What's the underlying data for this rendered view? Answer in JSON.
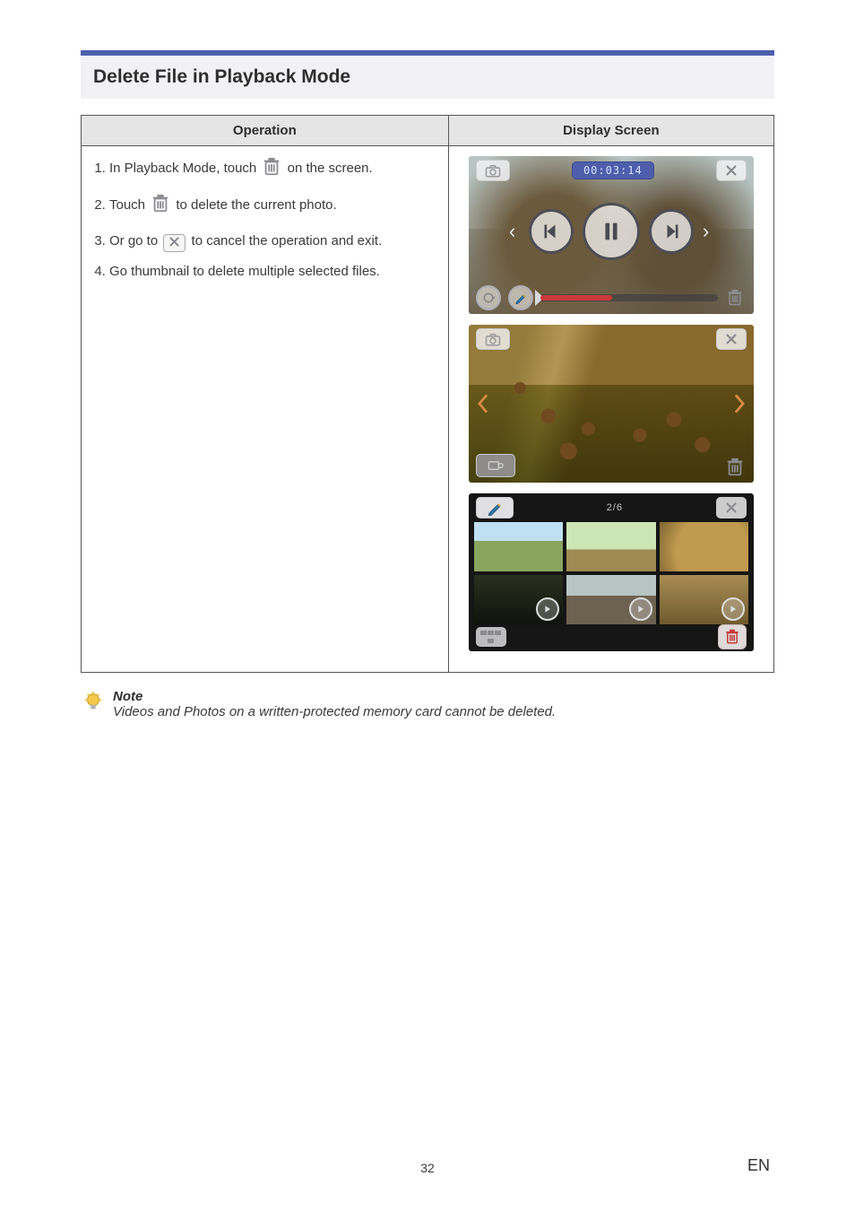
{
  "section": {
    "title": "Delete File in Playback Mode"
  },
  "table": {
    "headers": {
      "operation": "Operation",
      "display": "Display Screen"
    }
  },
  "operations": {
    "step1_a": "In Playback Mode, touch ",
    "step1_b": " on the screen.",
    "step2_a": "Touch ",
    "step2_b": " to delete the current photo.",
    "step3_a": "Or go to ",
    "step3_b": " to cancel the operation and exit.",
    "step4": "Go thumbnail to delete multiple selected files."
  },
  "icons": {
    "trash": "trash-icon",
    "x": "x-icon",
    "camera": "camera-icon",
    "close": "close-icon",
    "prev": "prev-icon",
    "next": "next-icon",
    "pause": "pause-icon",
    "loop": "loop-icon",
    "pen": "pen-icon",
    "mode": "mode-icon",
    "grid": "grid-icon",
    "play": "play-icon",
    "bulb": "bulb-icon"
  },
  "screens": {
    "s1": {
      "time": "00:03:14"
    },
    "s3": {
      "count": "2/6"
    }
  },
  "note": {
    "title": "Note",
    "text": "Videos and Photos on a written-protected memory card cannot be deleted."
  },
  "footer": {
    "page": "32",
    "lang": "EN"
  }
}
